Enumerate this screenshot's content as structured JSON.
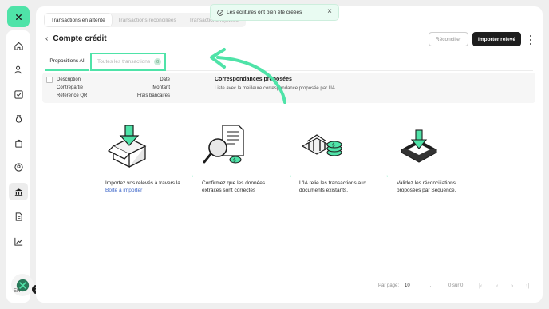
{
  "top_tabs": [
    {
      "label": "Transactions en attente"
    },
    {
      "label": "Transactions réconciliées"
    },
    {
      "label": "Transactions rejetées"
    }
  ],
  "toast": {
    "message": "Les écritures ont bien été créées"
  },
  "header": {
    "title": "Compte crédit",
    "reconcile_label": "Réconcilier",
    "import_label": "Importer relevé"
  },
  "subtabs": {
    "ai_label": "Propositions AI",
    "all_label": "Toutes les transactions",
    "all_count": "0"
  },
  "table": {
    "col_left": [
      "Description",
      "Contrepartie",
      "Référence QR"
    ],
    "col_right": [
      "Date",
      "Montant",
      "Frais bancaires"
    ],
    "match_title": "Correspondances proposées",
    "match_subtitle": "Liste avec la meilleure correspondance proposée par l'IA"
  },
  "steps": [
    {
      "text": "Importez vos relevés à travers la",
      "link": "Boîte à importer"
    },
    {
      "text": "Confirmez que les données extraites sont correctes"
    },
    {
      "text": "L'IA relie les transactions aux documents existants."
    },
    {
      "text": "Validez les réconciliations proposées par Sequence."
    }
  ],
  "pagination": {
    "per_page_label": "Par page:",
    "per_page_value": "10",
    "range": "0 sur 0"
  },
  "user": {
    "initials": "ER",
    "badge": "30"
  },
  "colors": {
    "accent": "#4fe3a8",
    "primary_button": "#1d1d1d",
    "link": "#3a64c8"
  }
}
